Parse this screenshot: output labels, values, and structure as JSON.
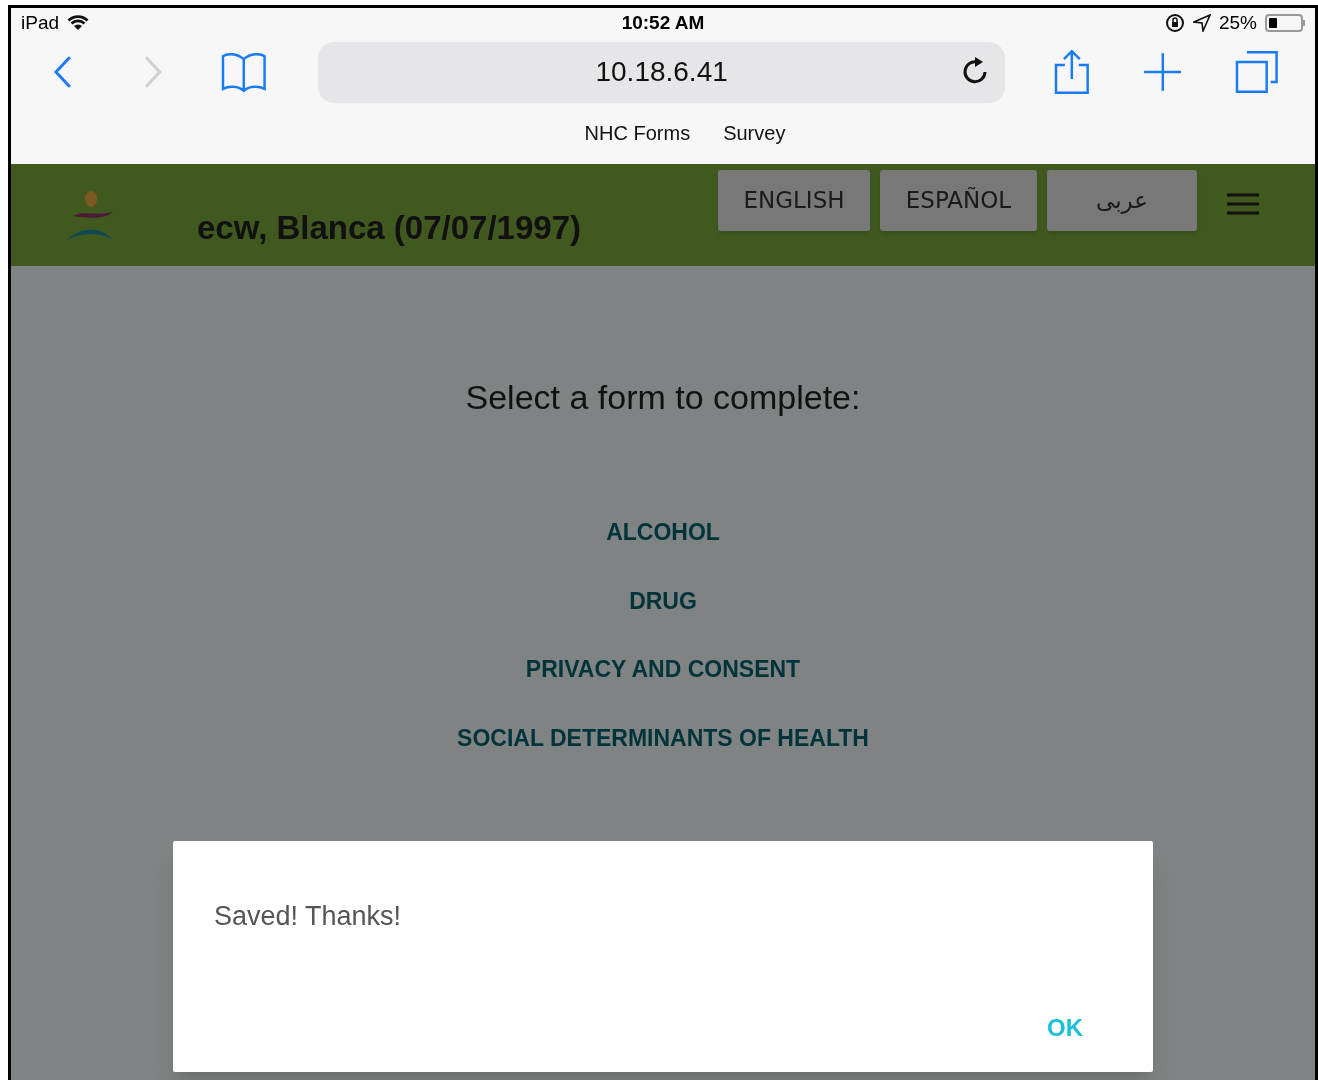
{
  "status_bar": {
    "device": "iPad",
    "time": "10:52 AM",
    "battery": "25%"
  },
  "browser": {
    "address": "10.18.6.41",
    "back_enabled": true,
    "forward_enabled": false,
    "favorites": [
      "NHC Forms",
      "Survey"
    ]
  },
  "header": {
    "patient": "ecw, Blanca (07/07/1997)",
    "languages": [
      "ENGLISH",
      "ESPAÑOL",
      "عربى"
    ]
  },
  "content": {
    "heading": "Select a form to complete:",
    "forms": [
      "ALCOHOL",
      "DRUG",
      "PRIVACY AND CONSENT",
      "SOCIAL DETERMINANTS OF HEALTH"
    ]
  },
  "dialog": {
    "message": "Saved! Thanks!",
    "button": "OK"
  }
}
